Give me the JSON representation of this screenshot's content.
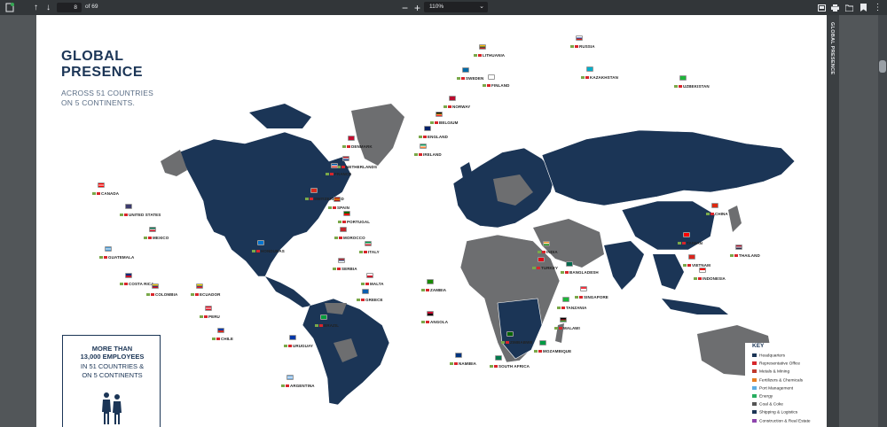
{
  "toolbar": {
    "page_current": "8",
    "page_total": "of 69",
    "zoom": "110%"
  },
  "side_tab": "GLOBAL PRESENCE",
  "title": {
    "line1": "GLOBAL",
    "line2": "PRESENCE",
    "sub1": "ACROSS 51 COUNTRIES",
    "sub2": "ON 5 CONTINENTS."
  },
  "callout": {
    "line1": "MORE THAN",
    "line2": "13,000 EMPLOYEES",
    "line3": "IN 51 COUNTRIES &",
    "line4": "ON 5 CONTINENTS"
  },
  "key": {
    "title": "KEY",
    "items": [
      {
        "label": "Headquarters",
        "color": "#1b3556"
      },
      {
        "label": "Representative Office",
        "color": "#d7262b"
      },
      {
        "label": "Metals & Mining",
        "color": "#c0392b"
      },
      {
        "label": "Fertilizers & Chemicals",
        "color": "#e67e22"
      },
      {
        "label": "Port Management",
        "color": "#5dade2"
      },
      {
        "label": "Energy",
        "color": "#27ae60"
      },
      {
        "label": "Coal & Coke",
        "color": "#555555"
      },
      {
        "label": "Shipping & Logistics",
        "color": "#1b3556"
      },
      {
        "label": "Construction & Real Estate",
        "color": "#8e44ad"
      }
    ]
  },
  "countries": [
    {
      "name": "RUSSIA",
      "flag": [
        "#ffffff",
        "#0039a6",
        "#d52b1e"
      ]
    },
    {
      "name": "LITHUANIA",
      "flag": [
        "#fdb913",
        "#006a44",
        "#c1272d"
      ]
    },
    {
      "name": "KAZAKHSTAN",
      "flag": [
        "#00afca"
      ]
    },
    {
      "name": "UZBEKISTAN",
      "flag": [
        "#1eb53a"
      ]
    },
    {
      "name": "SWEDEN",
      "flag": [
        "#006aa7"
      ]
    },
    {
      "name": "FINLAND",
      "flag": [
        "#ffffff"
      ]
    },
    {
      "name": "NORWAY",
      "flag": [
        "#ba0c2f"
      ]
    },
    {
      "name": "BELGIUM",
      "flag": [
        "#000000",
        "#fdda24",
        "#ef3340"
      ]
    },
    {
      "name": "ENGLAND",
      "flag": [
        "#012169"
      ]
    },
    {
      "name": "IRELAND",
      "flag": [
        "#169b62",
        "#ffffff",
        "#ff883e"
      ]
    },
    {
      "name": "DENMARK",
      "flag": [
        "#c60c30"
      ]
    },
    {
      "name": "NETHERLANDS",
      "flag": [
        "#ae1c28",
        "#ffffff",
        "#21468b"
      ]
    },
    {
      "name": "FRANCE",
      "flag": [
        "#0055a4",
        "#ffffff",
        "#ef4135"
      ]
    },
    {
      "name": "CANADA",
      "flag": [
        "#ff0000",
        "#ffffff",
        "#ff0000"
      ]
    },
    {
      "name": "SWITZERLAND",
      "flag": [
        "#d52b1e"
      ]
    },
    {
      "name": "SPAIN",
      "flag": [
        "#aa151b",
        "#f1bf00",
        "#aa151b"
      ]
    },
    {
      "name": "UNITED STATES",
      "flag": [
        "#3c3b6e"
      ]
    },
    {
      "name": "PORTUGAL",
      "flag": [
        "#006600",
        "#ff0000"
      ]
    },
    {
      "name": "MEXICO",
      "flag": [
        "#006847",
        "#ffffff",
        "#ce1126"
      ]
    },
    {
      "name": "MOROCCO",
      "flag": [
        "#c1272d"
      ]
    },
    {
      "name": "ITALY",
      "flag": [
        "#009246",
        "#ffffff",
        "#ce2b37"
      ]
    },
    {
      "name": "GUATEMALA",
      "flag": [
        "#4997d0",
        "#ffffff",
        "#4997d0"
      ]
    },
    {
      "name": "HONDURAS",
      "flag": [
        "#0073cf"
      ]
    },
    {
      "name": "SERBIA",
      "flag": [
        "#c6363c",
        "#0c4076",
        "#ffffff"
      ]
    },
    {
      "name": "MALTA",
      "flag": [
        "#ffffff",
        "#cf142b"
      ]
    },
    {
      "name": "COSTA RICA",
      "flag": [
        "#002b7f",
        "#ce1126"
      ]
    },
    {
      "name": "COLOMBIA",
      "flag": [
        "#fcd116",
        "#003893",
        "#ce1126"
      ]
    },
    {
      "name": "ECUADOR",
      "flag": [
        "#ffdd00",
        "#034ea2",
        "#ed1c24"
      ]
    },
    {
      "name": "GREECE",
      "flag": [
        "#0d5eaf"
      ]
    },
    {
      "name": "ZAMBIA",
      "flag": [
        "#198a00"
      ]
    },
    {
      "name": "PERU",
      "flag": [
        "#d91023",
        "#ffffff",
        "#d91023"
      ]
    },
    {
      "name": "BRAZIL",
      "flag": [
        "#009c3b"
      ]
    },
    {
      "name": "CHILE",
      "flag": [
        "#0039a6",
        "#d52b1e"
      ]
    },
    {
      "name": "URUGUAY",
      "flag": [
        "#0038a8"
      ]
    },
    {
      "name": "ANGOLA",
      "flag": [
        "#cc092f",
        "#000000"
      ]
    },
    {
      "name": "NAMIBIA",
      "flag": [
        "#003580"
      ]
    },
    {
      "name": "SOUTH AFRICA",
      "flag": [
        "#007a4d"
      ]
    },
    {
      "name": "ZIMBABWE",
      "flag": [
        "#006400"
      ]
    },
    {
      "name": "MOZAMBIQUE",
      "flag": [
        "#009a44"
      ]
    },
    {
      "name": "MALAWI",
      "flag": [
        "#000000",
        "#ce1126",
        "#339e35"
      ]
    },
    {
      "name": "TANZANIA",
      "flag": [
        "#1eb53a"
      ]
    },
    {
      "name": "TURKEY",
      "flag": [
        "#e30a17"
      ]
    },
    {
      "name": "INDIA",
      "flag": [
        "#ff9933",
        "#ffffff",
        "#138808"
      ]
    },
    {
      "name": "BANGLADESH",
      "flag": [
        "#006a4e"
      ]
    },
    {
      "name": "SINGAPORE",
      "flag": [
        "#ef3340",
        "#ffffff"
      ]
    },
    {
      "name": "CHINA",
      "flag": [
        "#de2910"
      ]
    },
    {
      "name": "TAIWAN",
      "flag": [
        "#fe0000"
      ]
    },
    {
      "name": "THAILAND",
      "flag": [
        "#a51931",
        "#f4f5f8",
        "#2d2a4a"
      ]
    },
    {
      "name": "VIETNAM",
      "flag": [
        "#da251d"
      ]
    },
    {
      "name": "INDONESIA",
      "flag": [
        "#ff0000",
        "#ffffff"
      ]
    },
    {
      "name": "ARGENTINA",
      "flag": [
        "#74acdf",
        "#ffffff",
        "#74acdf"
      ]
    }
  ]
}
